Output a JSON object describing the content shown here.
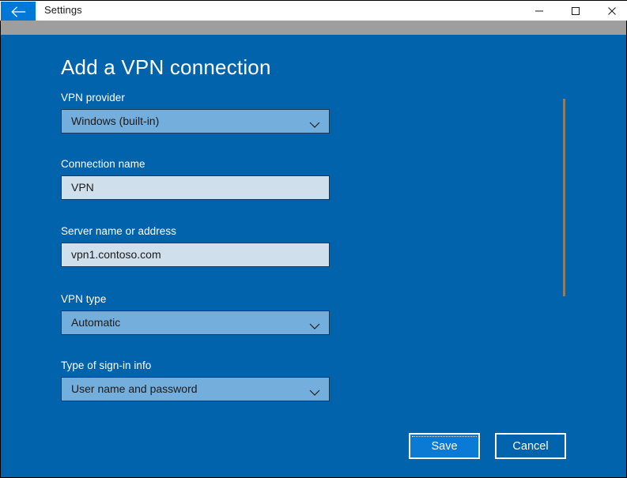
{
  "window": {
    "title": "Settings",
    "back_icon": "back-arrow-icon",
    "controls": {
      "minimize": "minimize-icon",
      "maximize": "maximize-icon",
      "close": "close-icon"
    }
  },
  "page": {
    "heading": "Add a VPN connection"
  },
  "form": {
    "fields": [
      {
        "label": "VPN provider",
        "type": "combobox",
        "value": "Windows (built-in)",
        "icon": "chevron-down-icon"
      },
      {
        "label": "Connection name",
        "type": "textbox",
        "value": "VPN"
      },
      {
        "label": "Server name or address",
        "type": "textbox",
        "value": "vpn1.contoso.com"
      },
      {
        "label": "VPN type",
        "type": "combobox",
        "value": "Automatic",
        "icon": "chevron-down-icon"
      },
      {
        "label": "Type of sign-in info",
        "type": "combobox",
        "value": "User name and password",
        "icon": "chevron-down-icon"
      }
    ]
  },
  "footer": {
    "save_label": "Save",
    "cancel_label": "Cancel"
  },
  "colors": {
    "accent": "#0078d7",
    "body_background": "#0263ad",
    "combobox_fill": "#74aedc",
    "textbox_fill": "#cfdfec",
    "save_fill": "#0a7ad4",
    "titlebar_fill": "#ffffff",
    "strip_fill": "#9e9e9e",
    "scrollbar_thumb": "#8b7f6b"
  }
}
